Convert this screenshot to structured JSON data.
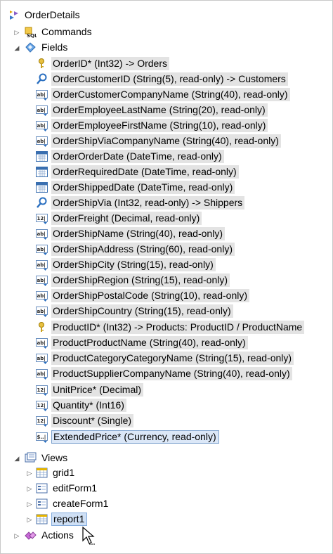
{
  "tree": {
    "root": {
      "label": "OrderDetails",
      "icon": "data-controller-icon"
    },
    "commands": {
      "label": "Commands",
      "icon": "sql-command-icon"
    },
    "fields": {
      "label": "Fields",
      "icon": "fields-icon",
      "items": [
        {
          "label": "OrderID* (Int32) -> Orders",
          "icon": "key-icon"
        },
        {
          "label": "OrderCustomerID (String(5), read-only) -> Customers",
          "icon": "lookup-icon"
        },
        {
          "label": "OrderCustomerCompanyName (String(40), read-only)",
          "icon": "text-field-icon"
        },
        {
          "label": "OrderEmployeeLastName (String(20), read-only)",
          "icon": "text-field-icon"
        },
        {
          "label": "OrderEmployeeFirstName (String(10), read-only)",
          "icon": "text-field-icon"
        },
        {
          "label": "OrderShipViaCompanyName (String(40), read-only)",
          "icon": "text-field-icon"
        },
        {
          "label": "OrderOrderDate (DateTime, read-only)",
          "icon": "calendar-icon"
        },
        {
          "label": "OrderRequiredDate (DateTime, read-only)",
          "icon": "calendar-icon"
        },
        {
          "label": "OrderShippedDate (DateTime, read-only)",
          "icon": "calendar-icon"
        },
        {
          "label": "OrderShipVia (Int32, read-only) -> Shippers",
          "icon": "lookup-icon"
        },
        {
          "label": "OrderFreight (Decimal, read-only)",
          "icon": "numeric-field-icon"
        },
        {
          "label": "OrderShipName (String(40), read-only)",
          "icon": "text-field-icon"
        },
        {
          "label": "OrderShipAddress (String(60), read-only)",
          "icon": "text-field-icon"
        },
        {
          "label": "OrderShipCity (String(15), read-only)",
          "icon": "text-field-icon"
        },
        {
          "label": "OrderShipRegion (String(15), read-only)",
          "icon": "text-field-icon"
        },
        {
          "label": "OrderShipPostalCode (String(10), read-only)",
          "icon": "text-field-icon"
        },
        {
          "label": "OrderShipCountry (String(15), read-only)",
          "icon": "text-field-icon"
        },
        {
          "label": "ProductID* (Int32) -> Products: ProductID / ProductName",
          "icon": "key-icon"
        },
        {
          "label": "ProductProductName (String(40), read-only)",
          "icon": "text-field-icon"
        },
        {
          "label": "ProductCategoryCategoryName (String(15), read-only)",
          "icon": "text-field-icon"
        },
        {
          "label": "ProductSupplierCompanyName (String(40), read-only)",
          "icon": "text-field-icon"
        },
        {
          "label": "UnitPrice* (Decimal)",
          "icon": "numeric-field-icon"
        },
        {
          "label": "Quantity* (Int16)",
          "icon": "numeric-field-icon"
        },
        {
          "label": "Discount* (Single)",
          "icon": "numeric-field-icon"
        },
        {
          "label": "ExtendedPrice* (Currency, read-only)",
          "icon": "currency-field-icon"
        }
      ]
    },
    "views": {
      "label": "Views",
      "icon": "views-icon",
      "items": [
        {
          "label": "grid1",
          "icon": "grid-view-icon"
        },
        {
          "label": "editForm1",
          "icon": "form-view-icon"
        },
        {
          "label": "createForm1",
          "icon": "form-view-icon"
        },
        {
          "label": "report1",
          "icon": "grid-view-icon"
        }
      ]
    },
    "actions": {
      "label": "Actions",
      "icon": "actions-icon"
    }
  }
}
